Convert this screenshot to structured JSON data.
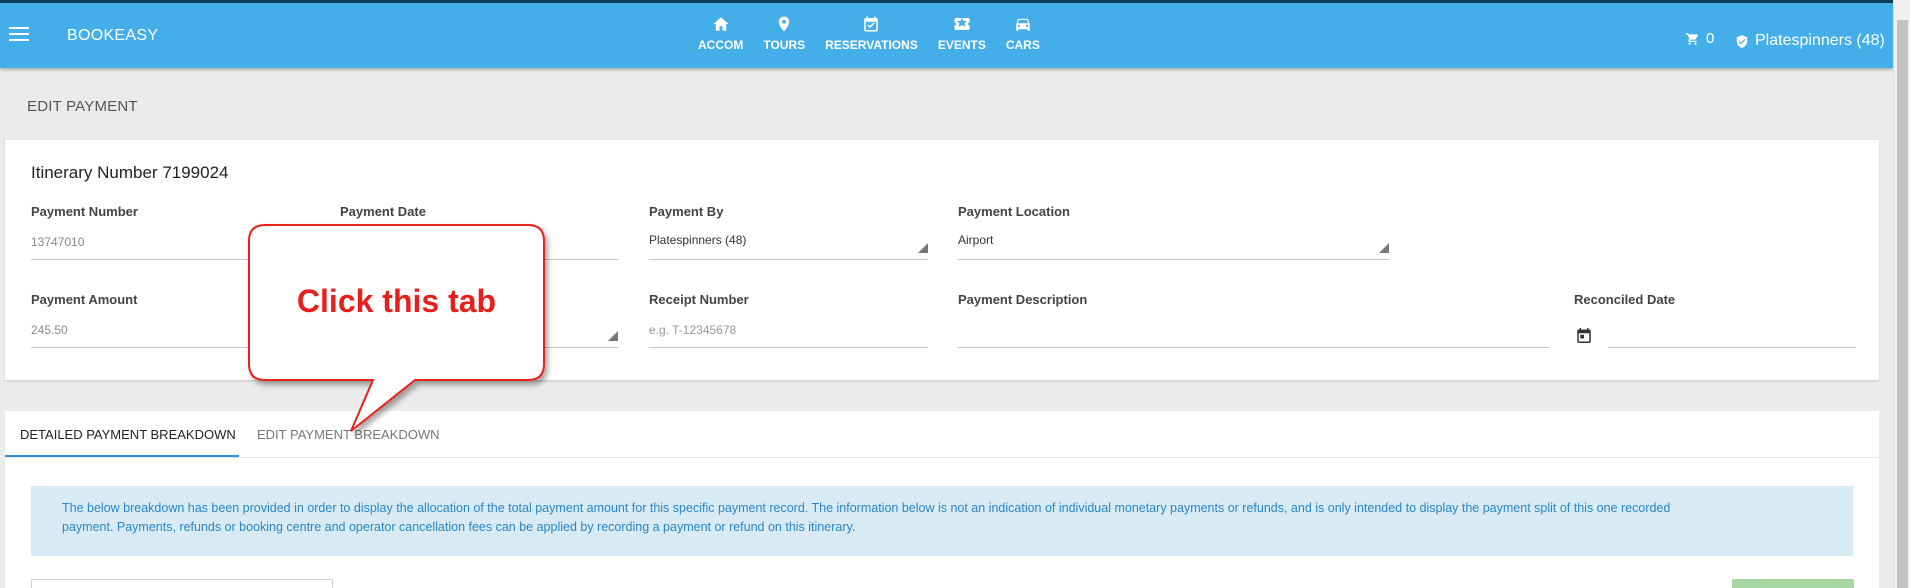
{
  "app": {
    "brand": "BOOKEASY"
  },
  "nav": [
    {
      "label": "ACCOM",
      "icon": "home-icon"
    },
    {
      "label": "TOURS",
      "icon": "map-pin-icon"
    },
    {
      "label": "RESERVATIONS",
      "icon": "calendar-check-icon"
    },
    {
      "label": "EVENTS",
      "icon": "ticket-icon"
    },
    {
      "label": "CARS",
      "icon": "car-icon"
    }
  ],
  "header": {
    "cart_count": "0",
    "account": "Platespinners (48)"
  },
  "page": {
    "title": "EDIT PAYMENT"
  },
  "payment": {
    "itinerary": "Itinerary Number 7199024",
    "payment_number_label": "Payment Number",
    "payment_number": "13747010",
    "payment_date_label": "Payment Date",
    "payment_by_label": "Payment By",
    "payment_by": "Platespinners (48)",
    "payment_location_label": "Payment Location",
    "payment_location": "Airport",
    "payment_amount_label": "Payment Amount",
    "payment_amount": "245.50",
    "receipt_number_label": "Receipt Number",
    "receipt_placeholder": "e.g. T-12345678",
    "payment_description_label": "Payment Description",
    "reconciled_date_label": "Reconciled Date"
  },
  "tabs": [
    {
      "label": "DETAILED PAYMENT BREAKDOWN",
      "active": true
    },
    {
      "label": "EDIT PAYMENT BREAKDOWN",
      "active": false
    }
  ],
  "info": {
    "line1": "The below breakdown has been provided in order to display the allocation of the total payment amount for this specific payment record. The information below is not an indication of individual monetary payments or refunds, and is only intended to display the payment split of this one recorded",
    "line2": "payment. Payments, refunds or booking centre and operator cancellation fees can be applied by recording a payment or refund on this itinerary."
  },
  "callout": {
    "text": "Click this tab"
  },
  "colors": {
    "topbar": "#44aee9",
    "callout_border": "#e8201d",
    "tab_active": "#2d8fd5",
    "info_bg": "#d8ebf4"
  }
}
